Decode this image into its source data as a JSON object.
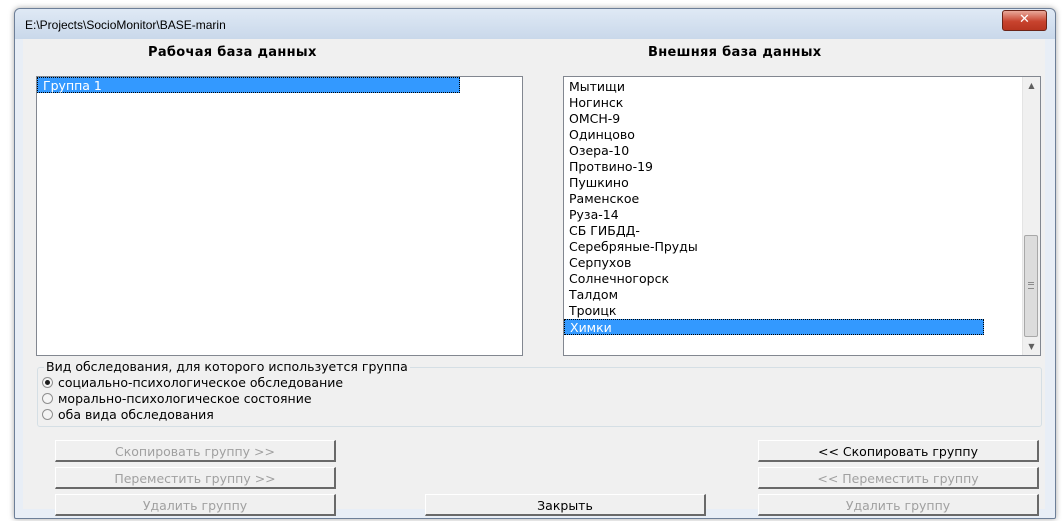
{
  "window": {
    "title": "E:\\Projects\\SocioMonitor\\BASE-marin",
    "close_glyph": "✕"
  },
  "left_panel": {
    "heading": "Рабочая база данных",
    "items": [
      {
        "label": "Группа 1",
        "selected": true
      }
    ]
  },
  "right_panel": {
    "heading": "Внешняя база данных",
    "items": [
      {
        "label": "Мытищи"
      },
      {
        "label": "Ногинск"
      },
      {
        "label": "ОМСН-9"
      },
      {
        "label": "Одинцово"
      },
      {
        "label": "Озера-10"
      },
      {
        "label": "Протвино-19"
      },
      {
        "label": "Пушкино"
      },
      {
        "label": "Раменское"
      },
      {
        "label": "Руза-14"
      },
      {
        "label": "СБ ГИБДД-"
      },
      {
        "label": "Серебряные-Пруды"
      },
      {
        "label": "Серпухов"
      },
      {
        "label": "Солнечногорск"
      },
      {
        "label": "Талдом"
      },
      {
        "label": "Троицк"
      },
      {
        "label": "Химки",
        "selected": true
      }
    ],
    "scrollbar": {
      "up_arrow": "▲",
      "down_arrow": "▼"
    }
  },
  "survey_type": {
    "legend": "Вид обследования, для которого используется группа",
    "options": [
      {
        "label": "социально-психологическое обследование",
        "checked": true
      },
      {
        "label": "морально-психологическое состояние",
        "checked": false
      },
      {
        "label": "оба вида обследования",
        "checked": false
      }
    ]
  },
  "buttons": {
    "copy_right": "Скопировать группу  >>",
    "move_right": "Переместить группу  >>",
    "delete_left": "Удалить группу",
    "close": "Закрыть",
    "copy_left": "<<  Скопировать группу",
    "move_left": "<<  Переместить группу",
    "delete_right": "Удалить группу"
  }
}
